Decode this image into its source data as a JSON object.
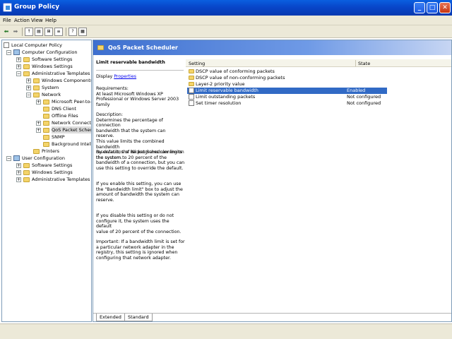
{
  "window": {
    "title": "Group Policy"
  },
  "menu": [
    "File",
    "Action",
    "View",
    "Help"
  ],
  "toolbar": {
    "back_icon": "arrow-left-icon",
    "forward_icon": "arrow-right-icon"
  },
  "tree": {
    "items": [
      {
        "label": "Local Computer Policy",
        "icon": "scroll"
      },
      {
        "label": "Computer Configuration",
        "icon": "computer",
        "exp": "−"
      },
      {
        "label": "Software Settings",
        "icon": "folder",
        "exp": "+"
      },
      {
        "label": "Windows Settings",
        "icon": "folder",
        "exp": "+"
      },
      {
        "label": "Administrative Templates",
        "icon": "folder",
        "exp": "−"
      },
      {
        "label": "Windows Components",
        "icon": "folder",
        "exp": "+"
      },
      {
        "label": "System",
        "icon": "folder",
        "exp": "+"
      },
      {
        "label": "Network",
        "icon": "folder",
        "exp": "−"
      },
      {
        "label": "Microsoft Peer-to-P",
        "icon": "folder",
        "exp": "+"
      },
      {
        "label": "DNS Client",
        "icon": "folder",
        "exp": ""
      },
      {
        "label": "Offline Files",
        "icon": "folder",
        "exp": ""
      },
      {
        "label": "Network Connectio",
        "icon": "folder",
        "exp": "+"
      },
      {
        "label": "QoS Packet Schedu",
        "icon": "folder",
        "exp": "+"
      },
      {
        "label": "SNMP",
        "icon": "folder",
        "exp": ""
      },
      {
        "label": "Background Intellig",
        "icon": "folder",
        "exp": ""
      },
      {
        "label": "Printers",
        "icon": "folder",
        "exp": ""
      },
      {
        "label": "User Configuration",
        "icon": "computer",
        "exp": "−"
      },
      {
        "label": "Software Settings",
        "icon": "folder",
        "exp": "+"
      },
      {
        "label": "Windows Settings",
        "icon": "folder",
        "exp": "+"
      },
      {
        "label": "Administrative Templates",
        "icon": "folder",
        "exp": "+"
      }
    ]
  },
  "panel": {
    "title": "QoS Packet Scheduler"
  },
  "description": {
    "title": "Limit reservable bandwidth",
    "display_label": "Display",
    "properties_link": "Properties",
    "requirements": "Requirements:\nAt least Microsoft Windows XP\nProfessional or Windows Server 2003\nfamily",
    "body1": "Description:\nDetermines the percentage of connection\nbandwidth that the system can reserve.\nThis value limits the combined bandwidth\nreservations of all programs running on\nthe system.",
    "body2": "By default, the Packet Scheduler limits\nthe system to 20 percent of the\nbandwidth of a connection, but you can\nuse this setting to override the default.",
    "body3": "If you enable this setting, you can use\nthe \"Bandwidth limit\" box to adjust the\namount of bandwidth the system can\nreserve.",
    "body4": "If you disable this setting or do not\nconfigure it, the system uses the default\nvalue of 20 percent of the connection.",
    "body5": "Important: If a bandwidth limit is set for\na particular network adapter in the\nregistry, this setting is ignored when\nconfiguring that network adapter."
  },
  "list": {
    "col_setting": "Setting",
    "col_state": "State",
    "rows": [
      {
        "name": "DSCP value of conforming packets",
        "state": "",
        "icon": "folder"
      },
      {
        "name": "DSCP value of non-conforming packets",
        "state": "",
        "icon": "folder"
      },
      {
        "name": "Layer-2 priority value",
        "state": "",
        "icon": "folder"
      },
      {
        "name": "Limit reservable bandwidth",
        "state": "Enabled",
        "icon": "policy",
        "selected": true
      },
      {
        "name": "Limit outstanding packets",
        "state": "Not configured",
        "icon": "policy"
      },
      {
        "name": "Set timer resolution",
        "state": "Not configured",
        "icon": "policy"
      }
    ]
  },
  "tabs": [
    "Extended",
    "Standard"
  ]
}
